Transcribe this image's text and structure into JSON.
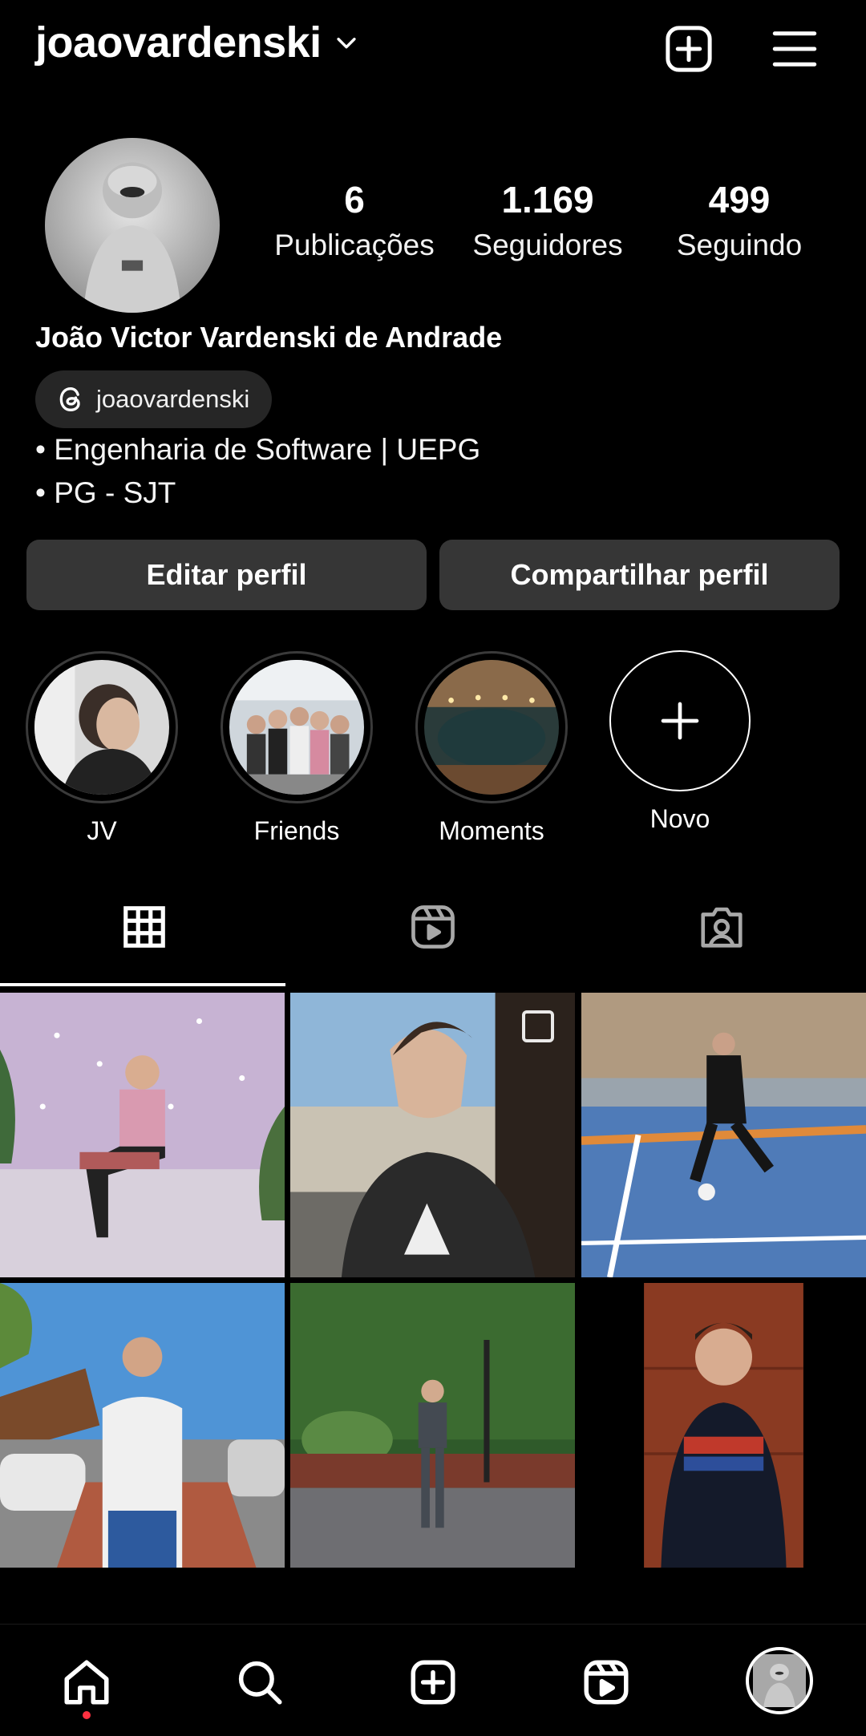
{
  "header": {
    "username": "joaovardenski"
  },
  "profile": {
    "full_name": "João Victor Vardenski de Andrade",
    "threads_handle": "joaovardenski",
    "bio_lines": [
      "• Engenharia de Software | UEPG",
      "• PG - SJT"
    ],
    "stats": {
      "posts": {
        "value": "6",
        "label": "Publicações"
      },
      "followers": {
        "value": "1.169",
        "label": "Seguidores"
      },
      "following": {
        "value": "499",
        "label": "Seguindo"
      }
    }
  },
  "actions": {
    "edit_label": "Editar perfil",
    "share_label": "Compartilhar perfil"
  },
  "highlights": [
    {
      "label": "JV"
    },
    {
      "label": "Friends"
    },
    {
      "label": "Moments"
    }
  ],
  "new_highlight_label": "Novo",
  "tabs": [
    {
      "icon": "grid-icon",
      "selected": true
    },
    {
      "icon": "reels-icon",
      "selected": false
    },
    {
      "icon": "tagged-icon",
      "selected": false
    }
  ],
  "nav": {
    "items": [
      "home-icon",
      "search-icon",
      "create-icon",
      "reels-icon",
      "profile-avatar"
    ],
    "active": "home-icon",
    "notification_dot_color": "#ff3040"
  },
  "colors": {
    "background": "#000000",
    "button": "#363636",
    "chip": "#262626"
  }
}
